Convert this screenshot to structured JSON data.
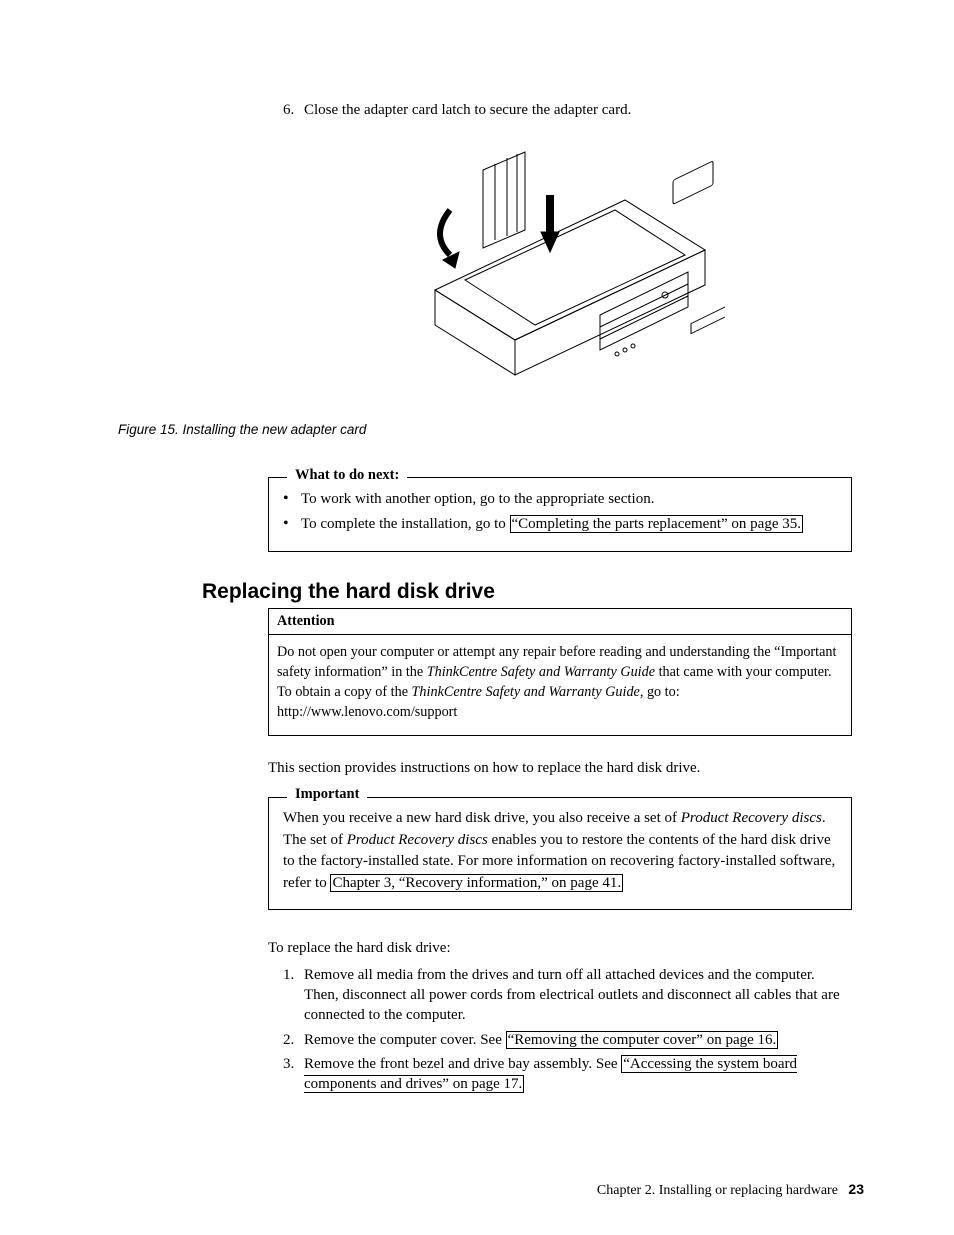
{
  "step6": {
    "number": "6.",
    "text": "Close the adapter card latch to secure the adapter card."
  },
  "figure_caption": "Figure 15. Installing the new adapter card",
  "whatnext": {
    "legend": "What to do next:",
    "bullet1": "To work with another option, go to the appropriate section.",
    "bullet2_prefix": "To complete the installation, go to ",
    "bullet2_link": "“Completing the parts replacement” on page 35."
  },
  "section_title": "Replacing the hard disk drive",
  "attention": {
    "title": "Attention",
    "l1a": "Do not open your computer or attempt any repair before reading and understanding the “Important safety information” in the ",
    "l1b": "ThinkCentre Safety and Warranty Guide",
    "l1c": " that came with your computer. To obtain a copy of the ",
    "l1d": "ThinkCentre Safety and Warranty Guide",
    "l1e": ", go to: http://www.lenovo.com/support"
  },
  "intro_para": "This section provides instructions on how to replace the hard disk drive.",
  "important": {
    "legend": "Important",
    "l1a": "When you receive a new hard disk drive, you also receive a set of ",
    "l1b": "Product Recovery discs",
    "l1c": ". The set of ",
    "l1d": "Product Recovery discs",
    "l1e": " enables you to restore the contents of the hard disk drive to the factory-installed state. For more information on recovering factory-installed software, refer to ",
    "l1f": "Chapter 3, “Recovery information,” on page 41."
  },
  "to_replace": "To replace the hard disk drive:",
  "steps": {
    "s1": "Remove all media from the drives and turn off all attached devices and the computer. Then, disconnect all power cords from electrical outlets and disconnect all cables that are connected to the computer.",
    "s2a": "Remove the computer cover. See ",
    "s2b": "“Removing the computer cover” on page 16.",
    "s3a": "Remove the front bezel and drive bay assembly. See ",
    "s3b": "“Accessing the system board components and drives” on page 17."
  },
  "footer": {
    "chapter": "Chapter 2. Installing or replacing hardware",
    "page": "23"
  }
}
